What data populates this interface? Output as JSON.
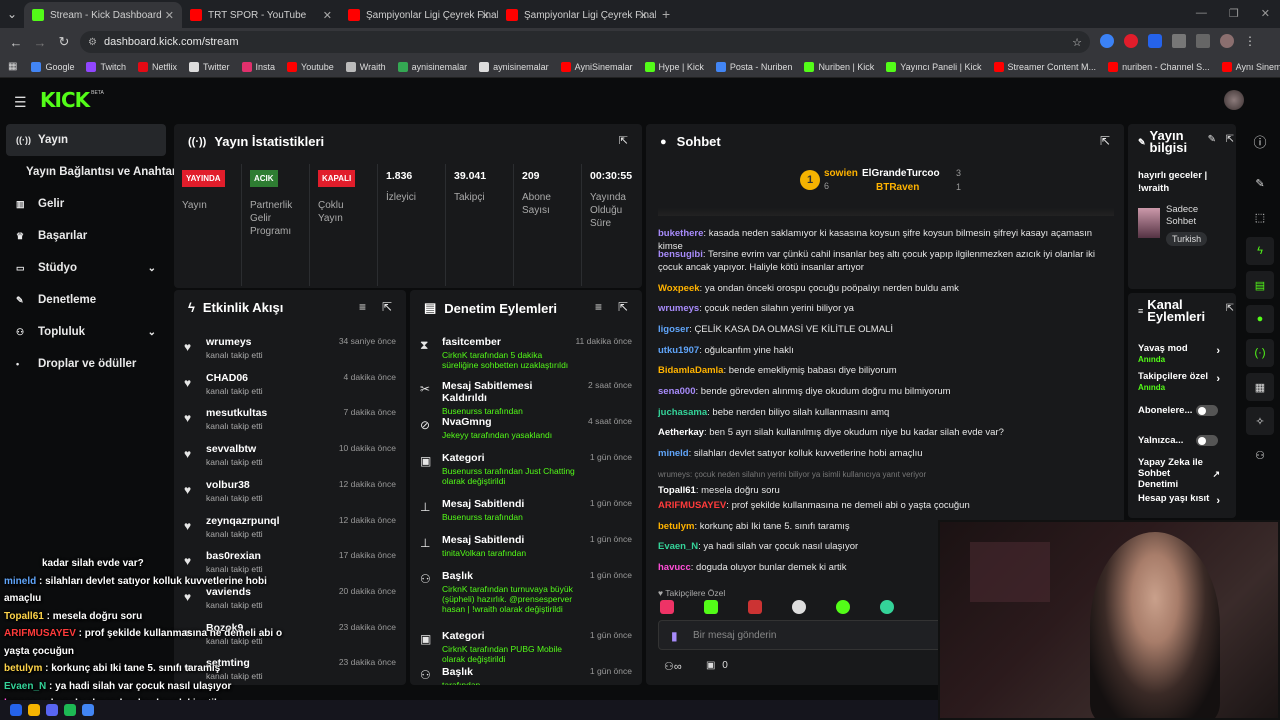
{
  "browser": {
    "tabs": [
      {
        "title": "Stream - Kick Dashboard",
        "active": true,
        "color": "#53fc18"
      },
      {
        "title": "TRT SPOR - YouTube",
        "active": false,
        "color": "#ff0000"
      },
      {
        "title": "Şampiyonlar Ligi Çeyrek Final |",
        "active": false,
        "color": "#ff0000"
      },
      {
        "title": "Şampiyonlar Ligi Çeyrek Final |",
        "active": false,
        "color": "#ff0000"
      }
    ],
    "url": "dashboard.kick.com/stream",
    "bookmarks": [
      "Google",
      "Twitch",
      "Netflix",
      "Twitter",
      "Insta",
      "Youtube",
      "Wraith",
      "aynisinemalar",
      "aynisinemalar",
      "AyniSinemalar",
      "Hype | Kick",
      "Posta - Nuriben",
      "Nuriben | Kick",
      "Yayıncı Paneli | Kick",
      "Streamer Content M...",
      "nuriben - Channel S...",
      "Aynı Sinemalar - Ça..."
    ]
  },
  "sidebar": {
    "items": [
      {
        "label": "Yayın",
        "icon": "signal-icon"
      },
      {
        "label": "Yayın Bağlantısı ve Anahtarı",
        "icon": ""
      },
      {
        "label": "Gelir",
        "icon": "chart-icon"
      },
      {
        "label": "Başarılar",
        "icon": "trophy-icon"
      },
      {
        "label": "Stüdyo",
        "icon": "studio-icon"
      },
      {
        "label": "Denetleme",
        "icon": "wrench-icon"
      },
      {
        "label": "Topluluk",
        "icon": "people-icon"
      },
      {
        "label": "Droplar ve ödüller",
        "icon": "gift-icon"
      }
    ]
  },
  "stats": {
    "title": "Yayın İstatistikleri",
    "cols": [
      {
        "badge": "YAYINDA",
        "badge_color": "#e11d2b",
        "label": "Yayın"
      },
      {
        "badge": "ACIK",
        "badge_color": "#2e7d32",
        "label": "Partnerlik Gelir Programı"
      },
      {
        "badge": "KAPALI",
        "badge_color": "#e11d2b",
        "label": "Çoklu Yayın"
      },
      {
        "value": "1.836",
        "label": "İzleyici"
      },
      {
        "value": "39.041",
        "label": "Takipçi"
      },
      {
        "value": "209",
        "label": "Abone Sayısı"
      },
      {
        "value": "00:30:55",
        "label": "Yayında Olduğu Süre"
      }
    ]
  },
  "activity": {
    "title": "Etkinlik Akışı",
    "items": [
      {
        "name": "wrumeys",
        "sub": "kanalı takip etti",
        "time": "34 saniye önce"
      },
      {
        "name": "CHAD06",
        "sub": "kanalı takip etti",
        "time": "4 dakika önce"
      },
      {
        "name": "mesutkultas",
        "sub": "kanalı takip etti",
        "time": "7 dakika önce"
      },
      {
        "name": "sevvalbtw",
        "sub": "kanalı takip etti",
        "time": "10 dakika önce"
      },
      {
        "name": "volbur38",
        "sub": "kanalı takip etti",
        "time": "12 dakika önce"
      },
      {
        "name": "zeynqazrpunql",
        "sub": "kanalı takip etti",
        "time": "12 dakika önce"
      },
      {
        "name": "bas0rexian",
        "sub": "kanalı takip etti",
        "time": "17 dakika önce"
      },
      {
        "name": "vaviends",
        "sub": "kanalı takip etti",
        "time": "20 dakika önce"
      },
      {
        "name": "Bozok9",
        "sub": "kanalı takip etti",
        "time": "23 dakika önce"
      },
      {
        "name": "setmting",
        "sub": "kanalı takip etti",
        "time": "23 dakika önce"
      }
    ]
  },
  "moderation": {
    "title": "Denetim Eylemleri",
    "items": [
      {
        "name": "fasitcember",
        "sub": "CirknK tarafından 5 dakika süreliğine sohbetten uzaklaştırıldı",
        "time": "11 dakika önce",
        "icon": "hourglass-icon"
      },
      {
        "name": "Mesaj Sabitlemesi Kaldırıldı",
        "sub": "Busenurss tarafından",
        "time": "2 saat önce",
        "icon": "unpin-icon"
      },
      {
        "name": "NvaGmng",
        "sub": "Jekeyy tarafından yasaklandı",
        "time": "4 saat önce",
        "icon": "ban-icon"
      },
      {
        "name": "Kategori",
        "sub": "Busenurss tarafından Just Chatting olarak değiştirildi",
        "time": "1 gün önce",
        "icon": "category-icon"
      },
      {
        "name": "Mesaj Sabitlendi",
        "sub": "Busenurss tarafından",
        "time": "1 gün önce",
        "icon": "pin-icon"
      },
      {
        "name": "Mesaj Sabitlendi",
        "sub": "tinitaVolkan tarafından",
        "time": "1 gün önce",
        "icon": "pin-icon"
      },
      {
        "name": "Başlık",
        "sub": "CirknK tarafından turnuvaya büyük (şüpheli) hazırlık. @prensesperver hasan | !wraith olarak değiştirildi",
        "time": "1 gün önce",
        "icon": "title-icon"
      },
      {
        "name": "Kategori",
        "sub": "CirknK tarafından PUBG Mobile olarak değiştirildi",
        "time": "1 gün önce",
        "icon": "category-icon"
      },
      {
        "name": "Başlık",
        "sub": "tarafından",
        "time": "1 gün önce",
        "icon": "title-icon"
      }
    ]
  },
  "chat": {
    "title": "Sohbet",
    "leaderboard": {
      "first": "sowien",
      "first_count": "6",
      "second": "ElGrandeTurcoo",
      "second_count": "3",
      "third": "BTRaven",
      "third_count": "1"
    },
    "messages": [
      {
        "user": "bukethere",
        "color": "#a78bfa",
        "text": "kasada neden saklamıyor ki kasasına koysun şifre koysun bilmesin şifreyi kasayı açamasın kimse"
      },
      {
        "user": "bensugibi",
        "color": "#a78bfa",
        "text": "Tersine evrim var çünkü cahil insanlar beş altı çocuk yapıp ilgilenmezken azıcık iyi olanlar iki çocuk ancak yapıyor. Haliyle kötü insanlar artıyor"
      },
      {
        "user": "Woxpeek",
        "color": "#ffb300",
        "text": "ya ondan önceki orospu çocuğu poöpalıyı nerden buldu amk"
      },
      {
        "user": "wrumeys",
        "color": "#a78bfa",
        "text": "çocuk neden silahın yerini biliyor ya"
      },
      {
        "user": "ligoser",
        "color": "#60a5fa",
        "text": "ÇELİK KASA DA OLMASİ VE KİLİTLE OLMALİ"
      },
      {
        "user": "utku1907",
        "color": "#60a5fa",
        "text": "oğulcanfım yine haklı"
      },
      {
        "user": "BidamlaDamla",
        "color": "#ffb300",
        "text": "bende emekliymiş babası diye biliyorum"
      },
      {
        "user": "sena000",
        "color": "#a78bfa",
        "text": "bende görevden alınmış diye okudum doğru mu bilmiyorum"
      },
      {
        "user": "juchasama",
        "color": "#34d399",
        "text": "bebe nerden biliyo silah kullanmasını amq"
      },
      {
        "user": "Aetherkay",
        "color": "#fff",
        "text": "ben 5 ayrı silah kullanılmış diye okudum niye bu kadar silah evde var?"
      },
      {
        "user": "mineld",
        "color": "#60a5fa",
        "text": "silahları devlet satıyor kolluk kuvvetlerine hobi amaçlıu"
      },
      {
        "user": "Topall61",
        "color": "#fff",
        "text": "mesela doğru soru"
      },
      {
        "user": "ARIFMUSAYEV",
        "color": "#ff3b3b",
        "text": "prof şekilde kullanmasına ne demeli abi o yaşta çocuğun"
      },
      {
        "user": "betulym",
        "color": "#ffb300",
        "text": "korkunç abi Iki tane 5. sınıfı taramış"
      },
      {
        "user": "Evaen_N",
        "color": "#34d399",
        "text": "ya hadi silah var çocuk nasıl ulaşıyor"
      },
      {
        "user": "havucc",
        "color": "#ff4fd8",
        "text": "doguda oluyor bunlar demek ki artik"
      }
    ],
    "reply_hint": "wrumeys: çocuk neden silahın yerini biliyor ya isimli kullanıcıya yanıt veriyor",
    "followers_only": "Takipçilere Özel",
    "input_placeholder": "Bir mesaj gönderin",
    "footer_count": "0"
  },
  "stream_info": {
    "title": "Yayın bilgisi",
    "stream_title": "hayırlı geceler | !wraith",
    "category": "Sadece Sohbet",
    "language": "Turkish"
  },
  "channel_actions": {
    "title": "Kanal Eylemleri",
    "items": [
      {
        "label": "Yavaş mod",
        "sub": "Anında",
        "type": "chevron"
      },
      {
        "label": "Takipçilere özel",
        "sub": "Anında",
        "type": "chevron"
      },
      {
        "label": "Abonelere...",
        "sub": "",
        "type": "toggle"
      },
      {
        "label": "Yalnızca...",
        "sub": "",
        "type": "toggle"
      },
      {
        "label": "Yapay Zeka ile Sohbet Denetimi",
        "sub": "",
        "type": "ext"
      },
      {
        "label": "Hesap yaşı kısıt",
        "sub": "",
        "type": "chevron"
      }
    ]
  },
  "overlay": {
    "lines": [
      {
        "user": "",
        "text": "kadar silah evde var?",
        "color": "#fff"
      },
      {
        "user": "mineld",
        "text": "silahları devlet satıyor kolluk kuvvetlerine hobi amaçlıu",
        "color": "#60a5fa"
      },
      {
        "user": "Topall61",
        "text": "mesela doğru soru",
        "color": "#ffd54a"
      },
      {
        "user": "ARIFMUSAYEV",
        "text": "prof şekilde kullanmasına ne demeli abi o yaşta çocuğun",
        "color": "#ff3b3b"
      },
      {
        "user": "betulym",
        "text": "korkunç abi Iki tane 5. sınıfı taramış",
        "color": "#ffd54a"
      },
      {
        "user": "Evaen_N",
        "text": "ya hadi silah var çocuk nasıl ulaşıyor",
        "color": "#34d399"
      },
      {
        "user": "havucc",
        "text": "doguda oluyor bunlar demek ki artik",
        "color": "#ff4fd8"
      }
    ]
  }
}
